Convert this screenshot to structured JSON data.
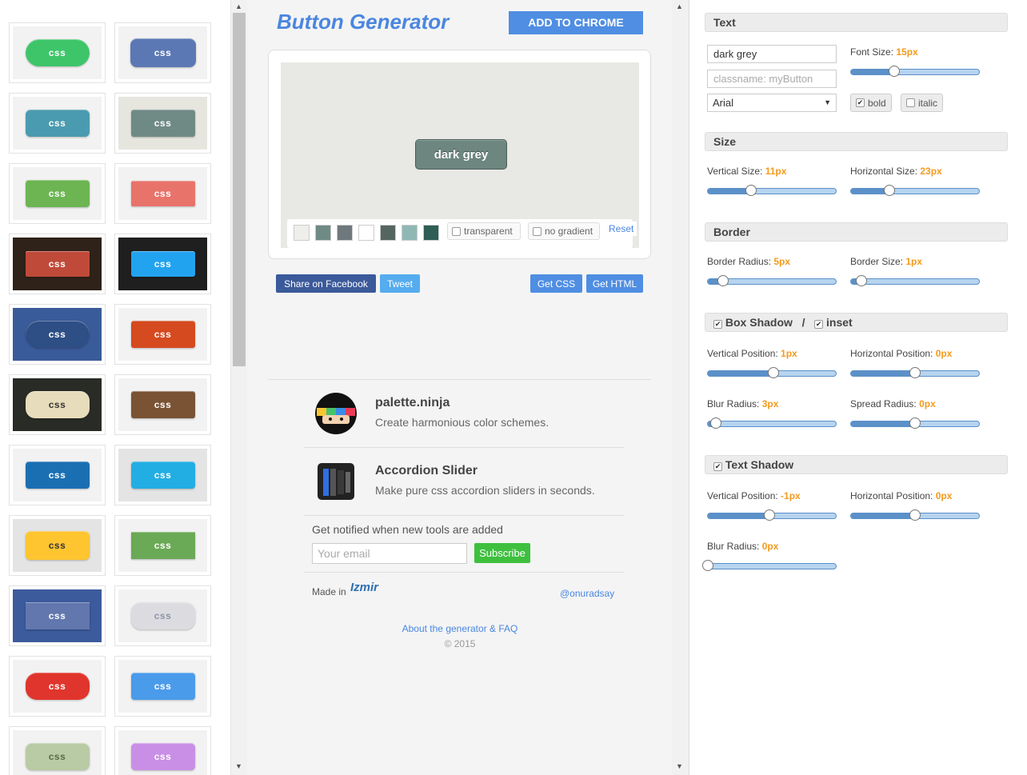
{
  "gallery": {
    "tile_label": "css",
    "tiles": [
      {
        "bg": "#f2f2f2",
        "btn": "#3ec56a",
        "text": "#ffffff",
        "w": 80,
        "h": 34,
        "r": 17
      },
      {
        "bg": "#f2f2f2",
        "btn": "#5b78b4",
        "text": "#ffffff",
        "w": 82,
        "h": 36,
        "r": 8
      },
      {
        "bg": "#f2f2f2",
        "btn": "#4a9bb0",
        "text": "#ffffff",
        "w": 80,
        "h": 34,
        "r": 6
      },
      {
        "bg": "#e6e6df",
        "btn": "#6f8a84",
        "text": "#ffffff",
        "w": 80,
        "h": 34,
        "r": 3
      },
      {
        "bg": "#f2f2f2",
        "btn": "#6cb552",
        "text": "#ffffff",
        "w": 80,
        "h": 34,
        "r": 4
      },
      {
        "bg": "#f2f2f2",
        "btn": "#e8736b",
        "text": "#ffffff",
        "w": 80,
        "h": 32,
        "r": 2
      },
      {
        "bg": "#2f2218",
        "btn": "#c04a3a",
        "text": "#ffffff",
        "w": 80,
        "h": 32,
        "r": 2
      },
      {
        "bg": "#1f1f1f",
        "btn": "#22a3f0",
        "text": "#ffffff",
        "w": 80,
        "h": 32,
        "r": 3
      },
      {
        "bg": "#3a5b9a",
        "btn": "#2e4e86",
        "text": "#ffffff",
        "w": 80,
        "h": 34,
        "r": 17
      },
      {
        "bg": "#f2f2f2",
        "btn": "#d54a1f",
        "text": "#ffffff",
        "w": 80,
        "h": 34,
        "r": 3
      },
      {
        "bg": "#292b26",
        "btn": "#e7dcbb",
        "text": "#333333",
        "w": 80,
        "h": 34,
        "r": 12
      },
      {
        "bg": "#f2f2f2",
        "btn": "#7a5234",
        "text": "#ffffff",
        "w": 80,
        "h": 34,
        "r": 3
      },
      {
        "bg": "#f2f2f2",
        "btn": "#1a6fb3",
        "text": "#ffffff",
        "w": 80,
        "h": 34,
        "r": 4
      },
      {
        "bg": "#e4e4e4",
        "btn": "#22aee3",
        "text": "#ffffff",
        "w": 80,
        "h": 34,
        "r": 4
      },
      {
        "bg": "#e4e4e4",
        "btn": "#ffc531",
        "text": "#333333",
        "w": 80,
        "h": 36,
        "r": 6
      },
      {
        "bg": "#f2f2f2",
        "btn": "#6aa955",
        "text": "#ffffff",
        "w": 80,
        "h": 34,
        "r": 0
      },
      {
        "bg": "#3c5b9c",
        "btn": "#6277ae",
        "text": "#ffffff",
        "w": 80,
        "h": 34,
        "r": 0
      },
      {
        "bg": "#f2f2f2",
        "btn": "#dcdce0",
        "text": "#8a96a8",
        "w": 80,
        "h": 34,
        "r": 12
      },
      {
        "bg": "#f2f2f2",
        "btn": "#e0352c",
        "text": "#ffffff",
        "w": 80,
        "h": 34,
        "r": 14
      },
      {
        "bg": "#f2f2f2",
        "btn": "#4a9bea",
        "text": "#ffffff",
        "w": 80,
        "h": 34,
        "r": 4
      },
      {
        "bg": "#f2f2f2",
        "btn": "#b9cba4",
        "text": "#5a6a4a",
        "w": 80,
        "h": 34,
        "r": 8
      },
      {
        "bg": "#f2f2f2",
        "btn": "#c98fe6",
        "text": "#ffffff",
        "w": 80,
        "h": 34,
        "r": 5
      }
    ]
  },
  "header": {
    "title": "Button Generator",
    "add_to_chrome": "ADD TO CHROME"
  },
  "preview": {
    "button_text": "dark grey",
    "swatches": [
      "#eeeeea",
      "#6f8a84",
      "#6f787c",
      "#ffffff",
      "#556661",
      "#8fb8b4",
      "#2e5e55"
    ],
    "transparent_label": "transparent",
    "no_gradient_label": "no gradient",
    "reset_label": "Reset"
  },
  "share": {
    "facebook": "Share on Facebook",
    "tweet": "Tweet",
    "get_css": "Get CSS",
    "get_html": "Get HTML"
  },
  "promos": [
    {
      "title": "palette.ninja",
      "desc": "Create harmonious color schemes."
    },
    {
      "title": "Accordion Slider",
      "desc": "Make pure css accordion sliders in seconds."
    }
  ],
  "newsletter": {
    "label": "Get notified when new tools are added",
    "placeholder": "Your email",
    "subscribe": "Subscribe"
  },
  "footer": {
    "made_in": "Made in",
    "izmir": "Izmir",
    "handle": "@onuradsay",
    "about": "About the generator & FAQ",
    "copyright": "© 2015"
  },
  "settings": {
    "text": {
      "header": "Text",
      "text_value": "dark grey",
      "classname_placeholder": "classname: myButton",
      "font_value": "Arial",
      "font_size_label": "Font Size: ",
      "font_size_value": "15px",
      "font_size_level": 0.34,
      "bold_label": "bold",
      "bold_checked": "✔",
      "italic_label": "italic"
    },
    "size": {
      "header": "Size",
      "vertical_label": "Vertical Size: ",
      "vertical_value": "11px",
      "vertical_level": 0.34,
      "horizontal_label": "Horizontal Size: ",
      "horizontal_value": "23px",
      "horizontal_level": 0.3
    },
    "border": {
      "header": "Border",
      "radius_label": "Border Radius: ",
      "radius_value": "5px",
      "radius_level": 0.12,
      "size_label": "Border Size: ",
      "size_value": "1px",
      "size_level": 0.08
    },
    "box_shadow": {
      "header": "Box Shadow",
      "separator": "/",
      "inset_label": "inset",
      "checkmark": "✔",
      "vpos_label": "Vertical Position: ",
      "vpos_value": "1px",
      "vpos_level": 0.51,
      "hpos_label": "Horizontal Position: ",
      "hpos_value": "0px",
      "hpos_level": 0.5,
      "blur_label": "Blur Radius: ",
      "blur_value": "3px",
      "blur_level": 0.06,
      "spread_label": "Spread Radius: ",
      "spread_value": "0px",
      "spread_level": 0.5
    },
    "text_shadow": {
      "header": "Text Shadow",
      "checkmark": "✔",
      "vpos_label": "Vertical Position: ",
      "vpos_value": "-1px",
      "vpos_level": 0.48,
      "hpos_label": "Horizontal Position: ",
      "hpos_value": "0px",
      "hpos_level": 0.5,
      "blur_label": "Blur Radius: ",
      "blur_value": "0px",
      "blur_level": 0.0
    }
  },
  "colors": {
    "accent": "#4a86e0",
    "value_orange": "#f39a1c"
  }
}
